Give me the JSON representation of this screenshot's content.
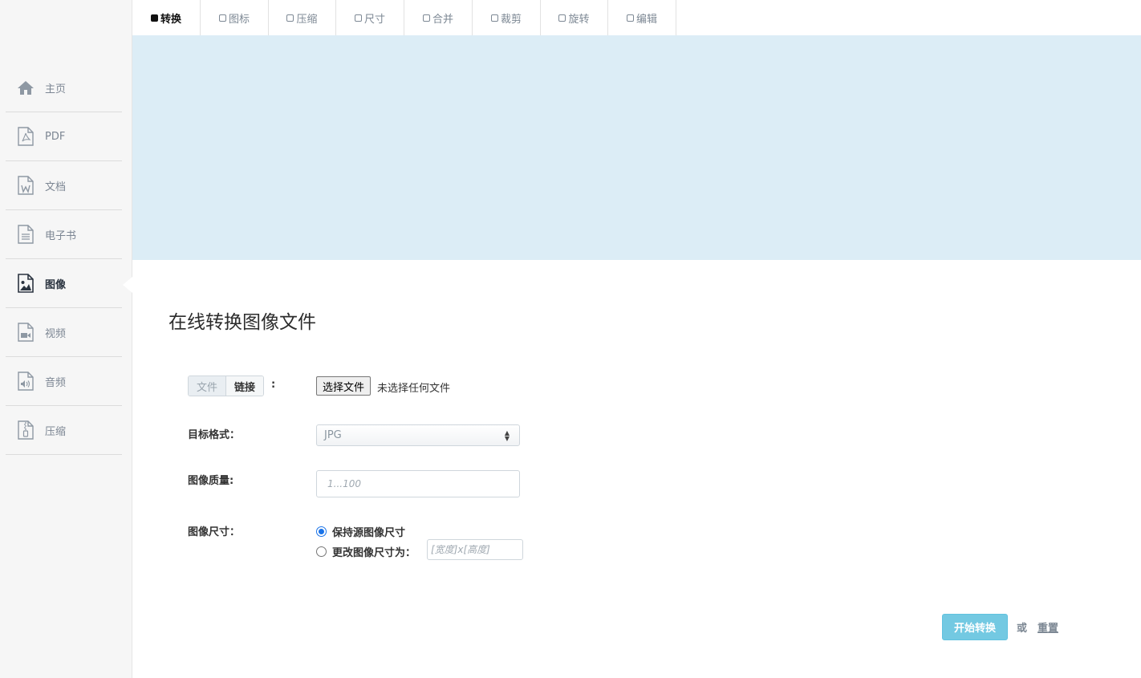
{
  "sidebar": {
    "items": [
      {
        "label": "主页",
        "icon": "home-icon"
      },
      {
        "label": "PDF",
        "icon": "pdf-file-icon"
      },
      {
        "label": "文档",
        "icon": "word-document-icon"
      },
      {
        "label": "电子书",
        "icon": "ebook-icon"
      },
      {
        "label": "图像",
        "icon": "image-file-icon",
        "active": true
      },
      {
        "label": "视频",
        "icon": "video-file-icon"
      },
      {
        "label": "音频",
        "icon": "audio-file-icon"
      },
      {
        "label": "压缩",
        "icon": "archive-file-icon"
      }
    ]
  },
  "tabs": [
    {
      "label": "转换",
      "active": true
    },
    {
      "label": "图标"
    },
    {
      "label": "压缩"
    },
    {
      "label": "尺寸"
    },
    {
      "label": "合并"
    },
    {
      "label": "裁剪"
    },
    {
      "label": "旋转"
    },
    {
      "label": "编辑"
    }
  ],
  "main": {
    "title": "在线转换图像文件",
    "source": {
      "file_label": "文件",
      "link_label": "链接",
      "colon": ":",
      "choose_button": "选择文件",
      "status": "未选择任何文件"
    },
    "format": {
      "label": "目标格式：",
      "value": "JPG"
    },
    "quality": {
      "label": "图像质量:",
      "placeholder": "1...100"
    },
    "size": {
      "label": "图像尺寸：",
      "option_keep": "保持源图像尺寸",
      "option_change": "更改图像尺寸为：",
      "placeholder": "[宽度]x[高度]"
    },
    "actions": {
      "start": "开始转换",
      "or": "或",
      "reset": "重置"
    }
  },
  "colors": {
    "banner": "#dcedf6",
    "start_button": "#5bc0de",
    "radio_accent": "#1a73e8"
  }
}
